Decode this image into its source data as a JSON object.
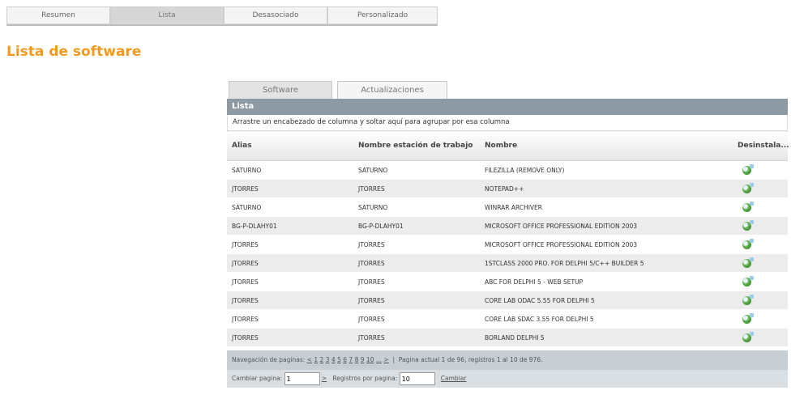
{
  "top_tabs": [
    {
      "label": "Resumen",
      "active": false
    },
    {
      "label": "Lista",
      "active": true
    },
    {
      "label": "Desasociado",
      "active": false
    },
    {
      "label": "Personalizado",
      "active": false
    }
  ],
  "page_title": "Lista de software",
  "inner_tabs": [
    {
      "label": "Software",
      "active": true
    },
    {
      "label": "Actualizaciones",
      "active": false
    }
  ],
  "grid": {
    "header": "Lista",
    "group_hint": "Arrastre un encabezado de columna y soltar aquí para agrupar por esa columna",
    "columns": [
      "Alias",
      "Nombre estación de trabajo",
      "Nombre",
      "Desinstala..."
    ],
    "rows": [
      [
        "SATURNO",
        "SATURNO",
        "FILEZILLA (REMOVE ONLY)"
      ],
      [
        "JTORRES",
        "JTORRES",
        "NOTEPAD++"
      ],
      [
        "SATURNO",
        "SATURNO",
        "WINRAR ARCHIVER"
      ],
      [
        "BG-P-DLAHY01",
        "BG-P-DLAHY01",
        "MICROSOFT OFFICE PROFESSIONAL EDITION 2003"
      ],
      [
        "JTORRES",
        "JTORRES",
        "MICROSOFT OFFICE PROFESSIONAL EDITION 2003"
      ],
      [
        "JTORRES",
        "JTORRES",
        "1STCLASS 2000 PRO. FOR DELPHI 5/C++ BUILDER 5"
      ],
      [
        "JTORRES",
        "JTORRES",
        "ABC FOR DELPHI 5 - WEB SETUP"
      ],
      [
        "JTORRES",
        "JTORRES",
        "CORE LAB ODAC 5.55 FOR DELPHI 5"
      ],
      [
        "JTORRES",
        "JTORRES",
        "CORE LAB SDAC 3.55 FOR DELPHI 5"
      ],
      [
        "JTORRES",
        "JTORRES",
        "BORLAND DELPHI 5"
      ]
    ],
    "uninstall_icon": "uninstall-icon"
  },
  "pager": {
    "nav_label": "Navegación de paginas:",
    "prev": "<",
    "pages": [
      "1",
      "2",
      "3",
      "4",
      "5",
      "6",
      "7",
      "8",
      "9",
      "10"
    ],
    "ellipsis": "...",
    "next": ">",
    "status": "Pagina actual 1 de 96, registros 1 al 10 de 976.",
    "change_page_label": "Cambiar pagina:",
    "change_page_value": "1",
    "go": ">",
    "per_page_label": "Registros por pagina:",
    "per_page_value": "10",
    "change_link": "Cambiar"
  },
  "colors": {
    "title": "#f39a1e",
    "grid_header": "#8d9aa3",
    "row_alt": "#ececec"
  }
}
